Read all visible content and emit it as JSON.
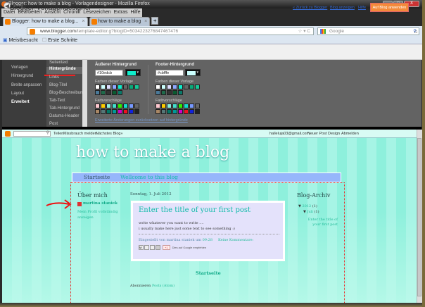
{
  "window": {
    "title": "Blogger: how to make a blog - Vorlagendesigner - Mozilla Firefox",
    "minimize": "–",
    "maximize": "□",
    "close": "X"
  },
  "menu": [
    "Datei",
    "Bearbeiten",
    "Ansicht",
    "Chronik",
    "Lesezeichen",
    "Extras",
    "Hilfe"
  ],
  "tabs": [
    {
      "label": "Blogger: how to make a blog..."
    },
    {
      "label": "how to make a blog"
    }
  ],
  "tab_close": "×",
  "new_tab": "+",
  "url": {
    "domain": "www.blogger.com",
    "path": "/template-editor.g?blogID=5034223276847467476"
  },
  "search": {
    "placeholder": "Google"
  },
  "bookmarks": [
    "Meistbesucht",
    "Erste Schritte"
  ],
  "designer": {
    "title": "Blogger-Vorlagendesigner",
    "links": [
      "« Zurück zu Blogger",
      "Blog anzeigen",
      "Hilfe"
    ],
    "apply": "Auf Blog anwenden",
    "nav": [
      "Vorlagen",
      "Hintergrund",
      "Breite anpassen",
      "Layout",
      "Erweitert"
    ],
    "sub": [
      "Seitentext",
      "Hintergründe",
      "Links",
      "Blog-Titel",
      "Blog-Beschreibung",
      "Tab-Text",
      "Tab-Hintergrund",
      "Datums-Header",
      "Post"
    ],
    "outer": {
      "label": "Äußerer Hintergrund",
      "hex": "#10edcb",
      "color": "#10edcb"
    },
    "footer": {
      "label": "Footer-Hintergrund",
      "hex": "#cbfffe",
      "color": "#cbfffe"
    },
    "template_colors_label": "Farben dieser Vorlage",
    "suggestions_label": "Farbvorschläge",
    "template_colors": [
      "#ffffff",
      "#cbfffe",
      "#ddddff",
      "#8fa8ff",
      "#10edcb",
      "#666666",
      "#0aa878",
      "#18c898",
      "#4a7a9a",
      "#1f6a4a",
      "#333333",
      "#0a5a30",
      "#0a7a6a"
    ],
    "suggestions": [
      "#ffc8d0",
      "#ffcc00",
      "#88eedd",
      "#44ddcc",
      "#33ee00",
      "#11ddcc",
      "#7799ff",
      "#666666",
      "#aa8866",
      "#557777",
      "#007766",
      "#009999",
      "#cc00cc",
      "#ee1122",
      "#1122dd",
      "#222222"
    ],
    "reset": "Erweiterte Änderungen zurücksetzen auf hintergründe"
  },
  "blognav": {
    "links": [
      "Teilen",
      "Missbrauch melden",
      "Nächstes Blog»"
    ],
    "right": [
      "halleluja03@gmail.com",
      "Neuer Post",
      "Design",
      "Abmelden"
    ]
  },
  "blog": {
    "title": "how to make a blog",
    "tabs": [
      "Startseite",
      "Wellcome to this blog"
    ],
    "about": {
      "heading": "Über mich",
      "name": "martina staniek",
      "profile": "Mein Profil vollständig anzeigen"
    },
    "date": "Sonntag, 1. Juli 2012",
    "post": {
      "title": "Enter the title of your first post",
      "line1": "write whatever you want to write ....",
      "line2": "i usually make here just some text to see something :)",
      "posted_by": "Eingestellt von martina staniek um",
      "time": "09:28",
      "comments": "Keine Kommentare:",
      "share": "Dies auf Google empfehlen",
      "plusone": "+1"
    },
    "home": "Startseite",
    "subscribe": "Abonnieren",
    "feed": "Posts (Atom)",
    "archive": {
      "heading": "Blog-Archiv",
      "year": "2012",
      "year_count": "(1)",
      "month": "Juli",
      "month_count": "(1)",
      "post": "Enter the title of your first post"
    }
  }
}
